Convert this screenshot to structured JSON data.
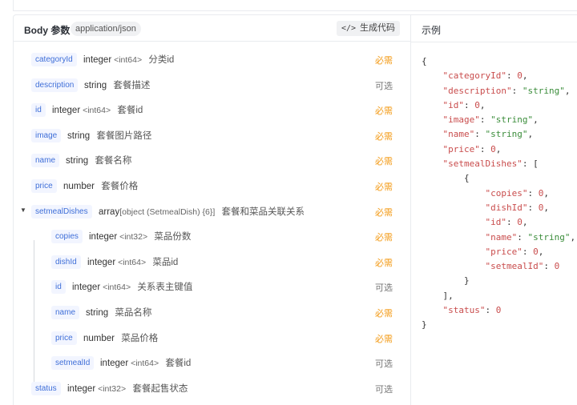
{
  "body_params": {
    "title": "Body 参数",
    "content_type": "application/json",
    "generate_code_icon": "</>",
    "generate_code_label": "生成代码"
  },
  "fields": [
    {
      "name": "categoryId",
      "type": "integer",
      "format": "<int64>",
      "desc": "分类id",
      "required": "必需"
    },
    {
      "name": "description",
      "type": "string",
      "format": "",
      "desc": "套餐描述",
      "required": "可选"
    },
    {
      "name": "id",
      "type": "integer",
      "format": "<int64>",
      "desc": "套餐id",
      "required": "必需"
    },
    {
      "name": "image",
      "type": "string",
      "format": "",
      "desc": "套餐图片路径",
      "required": "必需"
    },
    {
      "name": "name",
      "type": "string",
      "format": "",
      "desc": "套餐名称",
      "required": "必需"
    },
    {
      "name": "price",
      "type": "number",
      "format": "",
      "desc": "套餐价格",
      "required": "必需"
    },
    {
      "name": "setmealDishes",
      "type": "array",
      "format": "[object (SetmealDish) {6}]",
      "desc": "套餐和菜品关联关系",
      "required": "必需"
    },
    {
      "name": "copies",
      "type": "integer",
      "format": "<int32>",
      "desc": "菜品份数",
      "required": "必需"
    },
    {
      "name": "dishId",
      "type": "integer",
      "format": "<int64>",
      "desc": "菜品id",
      "required": "必需"
    },
    {
      "name": "id",
      "type": "integer",
      "format": "<int64>",
      "desc": "关系表主键值",
      "required": "可选"
    },
    {
      "name": "name",
      "type": "string",
      "format": "",
      "desc": "菜品名称",
      "required": "必需"
    },
    {
      "name": "price",
      "type": "number",
      "format": "",
      "desc": "菜品价格",
      "required": "必需"
    },
    {
      "name": "setmealId",
      "type": "integer",
      "format": "<int64>",
      "desc": "套餐id",
      "required": "可选"
    },
    {
      "name": "status",
      "type": "integer",
      "format": "<int32>",
      "desc": "套餐起售状态",
      "required": "可选"
    }
  ],
  "example": {
    "title": "示例",
    "lines": [
      [
        [
          "p",
          "{"
        ]
      ],
      [
        [
          "p",
          "    "
        ],
        [
          "k",
          "\"categoryId\""
        ],
        [
          "p",
          ": "
        ],
        [
          "n",
          "0"
        ],
        [
          "p",
          ","
        ]
      ],
      [
        [
          "p",
          "    "
        ],
        [
          "k",
          "\"description\""
        ],
        [
          "p",
          ": "
        ],
        [
          "s",
          "\"string\""
        ],
        [
          "p",
          ","
        ]
      ],
      [
        [
          "p",
          "    "
        ],
        [
          "k",
          "\"id\""
        ],
        [
          "p",
          ": "
        ],
        [
          "n",
          "0"
        ],
        [
          "p",
          ","
        ]
      ],
      [
        [
          "p",
          "    "
        ],
        [
          "k",
          "\"image\""
        ],
        [
          "p",
          ": "
        ],
        [
          "s",
          "\"string\""
        ],
        [
          "p",
          ","
        ]
      ],
      [
        [
          "p",
          "    "
        ],
        [
          "k",
          "\"name\""
        ],
        [
          "p",
          ": "
        ],
        [
          "s",
          "\"string\""
        ],
        [
          "p",
          ","
        ]
      ],
      [
        [
          "p",
          "    "
        ],
        [
          "k",
          "\"price\""
        ],
        [
          "p",
          ": "
        ],
        [
          "n",
          "0"
        ],
        [
          "p",
          ","
        ]
      ],
      [
        [
          "p",
          "    "
        ],
        [
          "k",
          "\"setmealDishes\""
        ],
        [
          "p",
          ": ["
        ]
      ],
      [
        [
          "p",
          "        {"
        ]
      ],
      [
        [
          "p",
          "            "
        ],
        [
          "k",
          "\"copies\""
        ],
        [
          "p",
          ": "
        ],
        [
          "n",
          "0"
        ],
        [
          "p",
          ","
        ]
      ],
      [
        [
          "p",
          "            "
        ],
        [
          "k",
          "\"dishId\""
        ],
        [
          "p",
          ": "
        ],
        [
          "n",
          "0"
        ],
        [
          "p",
          ","
        ]
      ],
      [
        [
          "p",
          "            "
        ],
        [
          "k",
          "\"id\""
        ],
        [
          "p",
          ": "
        ],
        [
          "n",
          "0"
        ],
        [
          "p",
          ","
        ]
      ],
      [
        [
          "p",
          "            "
        ],
        [
          "k",
          "\"name\""
        ],
        [
          "p",
          ": "
        ],
        [
          "s",
          "\"string\""
        ],
        [
          "p",
          ","
        ]
      ],
      [
        [
          "p",
          "            "
        ],
        [
          "k",
          "\"price\""
        ],
        [
          "p",
          ": "
        ],
        [
          "n",
          "0"
        ],
        [
          "p",
          ","
        ]
      ],
      [
        [
          "p",
          "            "
        ],
        [
          "k",
          "\"setmealId\""
        ],
        [
          "p",
          ": "
        ],
        [
          "n",
          "0"
        ]
      ],
      [
        [
          "p",
          "        }"
        ]
      ],
      [
        [
          "p",
          "    ],"
        ]
      ],
      [
        [
          "p",
          "    "
        ],
        [
          "k",
          "\"status\""
        ],
        [
          "p",
          ": "
        ],
        [
          "n",
          "0"
        ]
      ],
      [
        [
          "p",
          "}"
        ]
      ]
    ]
  },
  "colors": {
    "required": "#f39a15",
    "optional": "#777777",
    "name_tag_text": "#3f6fd8",
    "json_key": "#c94d4d",
    "json_string": "#3b8d3b"
  },
  "icons": {
    "expand": "caret-down-icon"
  }
}
